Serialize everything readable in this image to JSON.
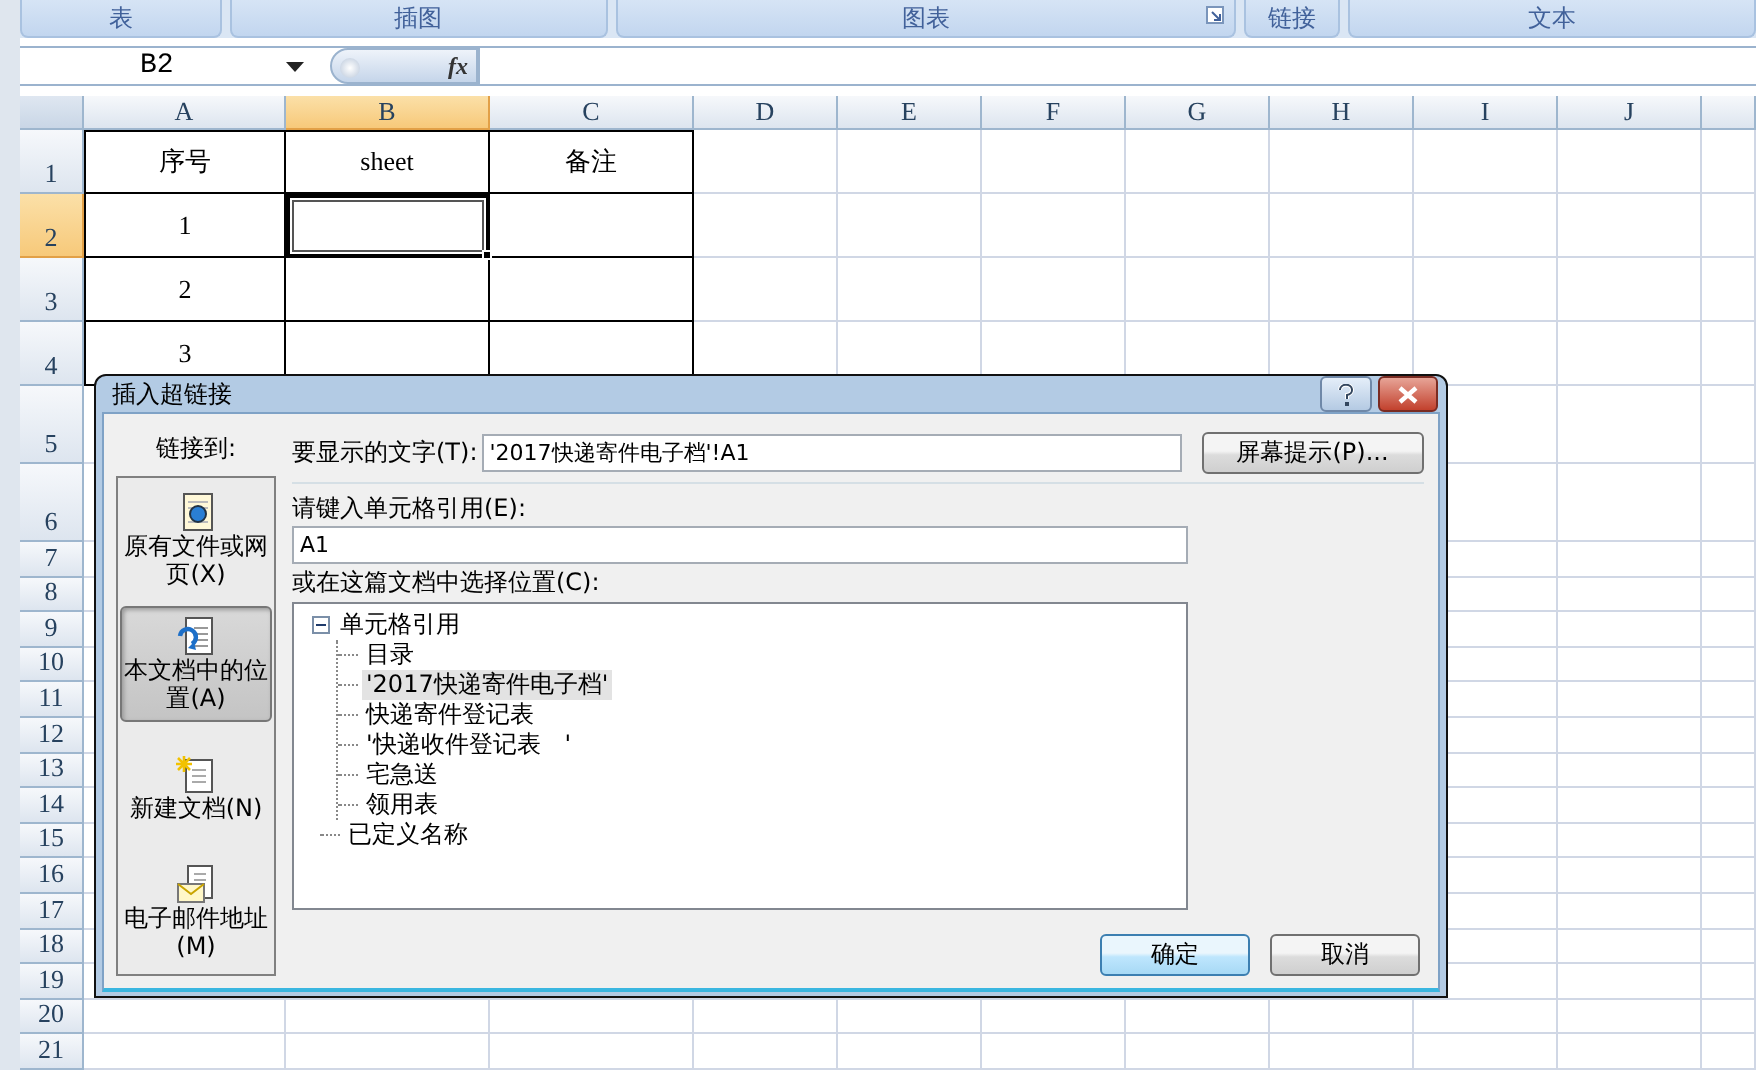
{
  "ribbon": {
    "groups": [
      {
        "label": "表",
        "launcher": false
      },
      {
        "label": "插图",
        "launcher": false
      },
      {
        "label": "图表",
        "launcher": true
      },
      {
        "label": "链接",
        "launcher": false
      },
      {
        "label": "文本",
        "launcher": false
      }
    ]
  },
  "formula_bar": {
    "name_box": "B2",
    "function_label": "fx"
  },
  "sheet": {
    "columns": [
      {
        "label": "A",
        "selected": false
      },
      {
        "label": "B",
        "selected": true
      },
      {
        "label": "C",
        "selected": false
      },
      {
        "label": "D",
        "selected": false
      },
      {
        "label": "E",
        "selected": false
      },
      {
        "label": "F",
        "selected": false
      },
      {
        "label": "G",
        "selected": false
      },
      {
        "label": "H",
        "selected": false
      },
      {
        "label": "I",
        "selected": false
      },
      {
        "label": "J",
        "selected": false
      }
    ],
    "rows": [
      {
        "label": "1",
        "selected": false,
        "cells": [
          {
            "text": "序号",
            "selected": false
          },
          {
            "text": "sheet",
            "selected": false
          },
          {
            "text": "备注",
            "selected": false
          }
        ]
      },
      {
        "label": "2",
        "selected": true,
        "cells": [
          {
            "text": "1",
            "selected": false
          },
          {
            "selected": true
          },
          {
            "selected": false
          }
        ]
      },
      {
        "label": "3",
        "selected": false,
        "cells": [
          {
            "text": "2",
            "selected": false
          },
          {
            "selected": false
          },
          {
            "selected": false
          }
        ]
      },
      {
        "label": "4",
        "selected": false,
        "cells": [
          {
            "text": "3",
            "selected": false
          },
          {
            "selected": false
          },
          {
            "selected": false
          }
        ]
      },
      {
        "label": "5",
        "selected": false
      },
      {
        "label": "6",
        "selected": false
      },
      {
        "label": "7",
        "selected": false
      },
      {
        "label": "8",
        "selected": false
      },
      {
        "label": "9",
        "selected": false
      },
      {
        "label": "10",
        "selected": false
      },
      {
        "label": "11",
        "selected": false
      },
      {
        "label": "12",
        "selected": false
      },
      {
        "label": "13",
        "selected": false
      },
      {
        "label": "14",
        "selected": false
      },
      {
        "label": "15",
        "selected": false
      },
      {
        "label": "16",
        "selected": false
      },
      {
        "label": "17",
        "selected": false
      },
      {
        "label": "18",
        "selected": false
      },
      {
        "label": "19",
        "selected": false
      },
      {
        "label": "20",
        "selected": false
      },
      {
        "label": "21",
        "selected": false
      }
    ]
  },
  "dialog": {
    "title": "插入超链接",
    "link_to_label": "链接到:",
    "link_targets": [
      {
        "kind": "file",
        "label": "原有文件或网页(X)",
        "selected": false
      },
      {
        "kind": "place",
        "label": "本文档中的位置(A)",
        "selected": true
      },
      {
        "kind": "new",
        "label": "新建文档(N)",
        "selected": false
      },
      {
        "kind": "email",
        "label": "电子邮件地址(M)",
        "selected": false
      }
    ],
    "display_text": {
      "label": "要显示的文字(T):",
      "value": "'2017快递寄件电子档'!A1"
    },
    "screen_tip_button": "屏幕提示(P)...",
    "cell_reference": {
      "label": "请键入单元格引用(E):",
      "value": "A1"
    },
    "location": {
      "label": "或在这篇文档中选择位置(C):",
      "tree": [
        {
          "label": "单元格引用",
          "selected": false,
          "expanded": true,
          "children": [
            {
              "label": "目录",
              "selected": false
            },
            {
              "label": "'2017快递寄件电子档'",
              "selected": true
            },
            {
              "label": "快递寄件登记表",
              "selected": false
            },
            {
              "label": "'快递收件登记表　'",
              "selected": false
            },
            {
              "label": "宅急送",
              "selected": false
            },
            {
              "label": "领用表",
              "selected": false
            }
          ]
        },
        {
          "label": "已定义名称",
          "selected": false
        }
      ]
    },
    "buttons": [
      {
        "label": "确定",
        "default": true
      },
      {
        "label": "取消",
        "default": false
      }
    ]
  }
}
